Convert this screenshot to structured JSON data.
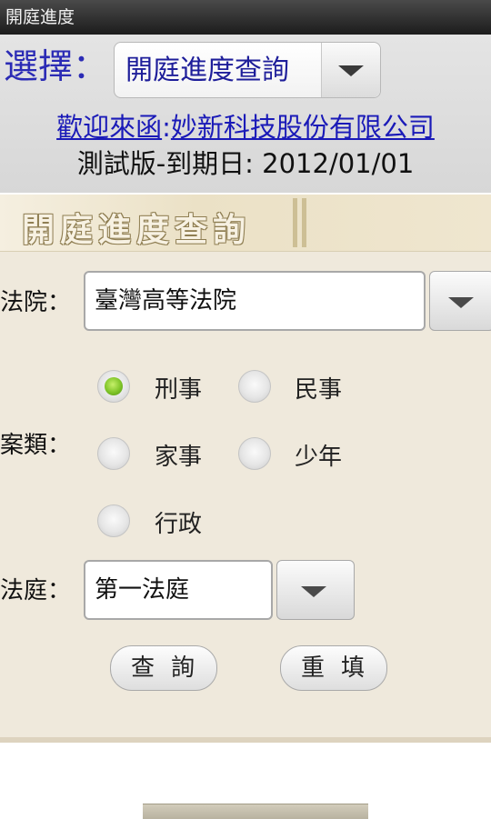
{
  "app": {
    "title": "開庭進度"
  },
  "header": {
    "select_label": "選擇：",
    "selected_function": "開庭進度查詢",
    "welcome_prefix": "歡迎來函",
    "welcome_sep": ":",
    "company": "妙新科技股份有限公司",
    "expiry": "測試版-到期日: 2012/01/01"
  },
  "banner": {
    "title": "開庭進度查詢"
  },
  "form": {
    "court_label": "法院：",
    "court_value": "臺灣高等法院",
    "case_type_label": "案類：",
    "case_types": [
      {
        "label": "刑事",
        "checked": true
      },
      {
        "label": "民事",
        "checked": false
      },
      {
        "label": "家事",
        "checked": false
      },
      {
        "label": "少年",
        "checked": false
      },
      {
        "label": "行政",
        "checked": false
      }
    ],
    "courtroom_label": "法庭：",
    "courtroom_value": "第一法庭",
    "query_button": "查詢",
    "reset_button": "重填"
  },
  "colors": {
    "accent_blue": "#1a1ab8",
    "radio_on": "#7fc428",
    "panel_bg": "#efe9dc"
  }
}
